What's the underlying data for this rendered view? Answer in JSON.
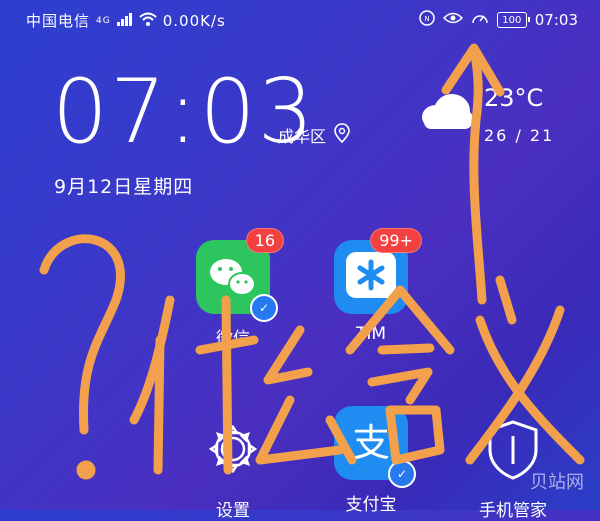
{
  "status_bar": {
    "carrier": "中国电信",
    "network": "4G",
    "speed": "0.00K/s",
    "battery": "100",
    "time": "07:03"
  },
  "lock": {
    "time": "07:03",
    "location": "成华区",
    "date": "9月12日星期四",
    "temperature": "23°C",
    "temp_range": "26 / 21"
  },
  "apps": [
    {
      "label": "微信",
      "badge": "16",
      "icon": "wechat-icon",
      "color": "#2dc55e"
    },
    {
      "label": "TIM",
      "badge": "99+",
      "icon": "tim-icon",
      "color": "#1f8cf2"
    },
    {
      "label": "设置",
      "icon": "settings-gear-icon",
      "color": "#ffffff"
    },
    {
      "label": "支付宝",
      "icon": "alipay-icon",
      "color": "#1f8cf2"
    },
    {
      "label": "手机管家",
      "icon": "phone-manager-icon",
      "color": "#ffffff"
    }
  ],
  "overlay_text": "?什么含义",
  "watermark": "贝站网",
  "colors": {
    "scribble": "#f2a04b",
    "badge": "#f34040"
  }
}
